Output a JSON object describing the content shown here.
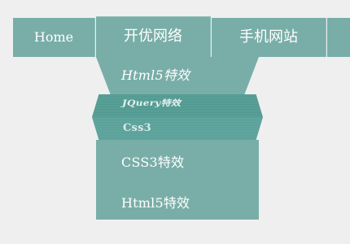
{
  "nav": {
    "items": [
      {
        "label": "Home"
      },
      {
        "label": "开优网络"
      },
      {
        "label": "手机网站"
      }
    ]
  },
  "dropdown": {
    "items": [
      {
        "label": "Html5特效"
      },
      {
        "label": "JQuery特效"
      },
      {
        "label": "Css3"
      },
      {
        "label": "CSS3特效"
      },
      {
        "label": "Html5特效"
      }
    ]
  },
  "colors": {
    "background": "#efefef",
    "nav_bg": "#79aea8",
    "fold_dark": "#4f9990",
    "fold_light": "#57a098",
    "text": "#ffffff"
  }
}
